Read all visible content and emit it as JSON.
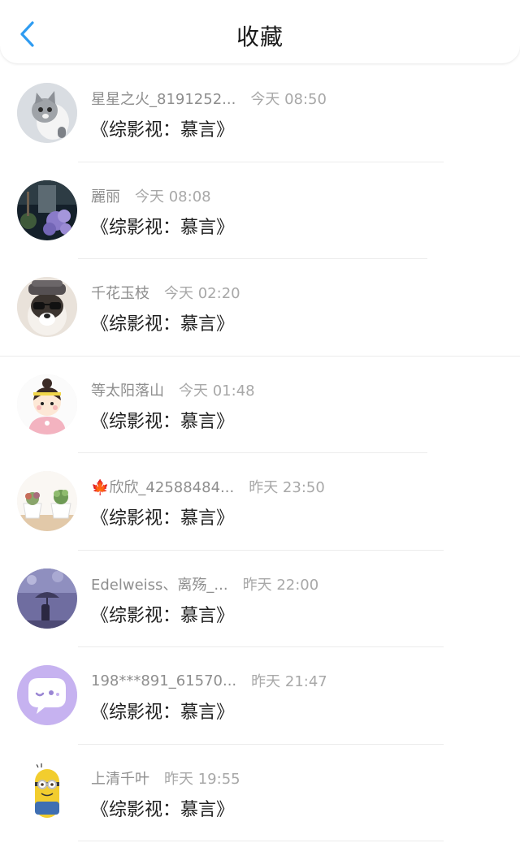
{
  "header": {
    "title": "收藏",
    "back_icon": "chevron-left-icon",
    "accent": "#2f9cf1"
  },
  "items": [
    {
      "name": "星星之火_8191252...",
      "time": "今天 08:50",
      "title": "《综影视：慕言》",
      "avatar": "cat-avatar"
    },
    {
      "name": "麗丽",
      "time": "今天 08:08",
      "title": "《综影视：慕言》",
      "avatar": "flower-avatar"
    },
    {
      "name": "千花玉枝",
      "time": "今天 02:20",
      "title": "《综影视：慕言》",
      "avatar": "dog-sunglasses-avatar"
    },
    {
      "name": "等太阳落山",
      "time": "今天 01:48",
      "title": "《综影视：慕言》",
      "avatar": "cartoon-girl-avatar"
    },
    {
      "name": "🍁欣欣_42588484...",
      "time": "昨天 23:50",
      "title": "《综影视：慕言》",
      "avatar": "succulents-avatar"
    },
    {
      "name": "Edelweiss、离殇_...",
      "time": "昨天 22:00",
      "title": "《综影视：慕言》",
      "avatar": "umbrella-figure-avatar"
    },
    {
      "name": "198***891_61570...",
      "time": "昨天 21:47",
      "title": "《综影视：慕言》",
      "avatar": "chat-bubble-avatar"
    },
    {
      "name": "上清千叶",
      "time": "昨天 19:55",
      "title": "《综影视：慕言》",
      "avatar": "minion-avatar"
    }
  ]
}
